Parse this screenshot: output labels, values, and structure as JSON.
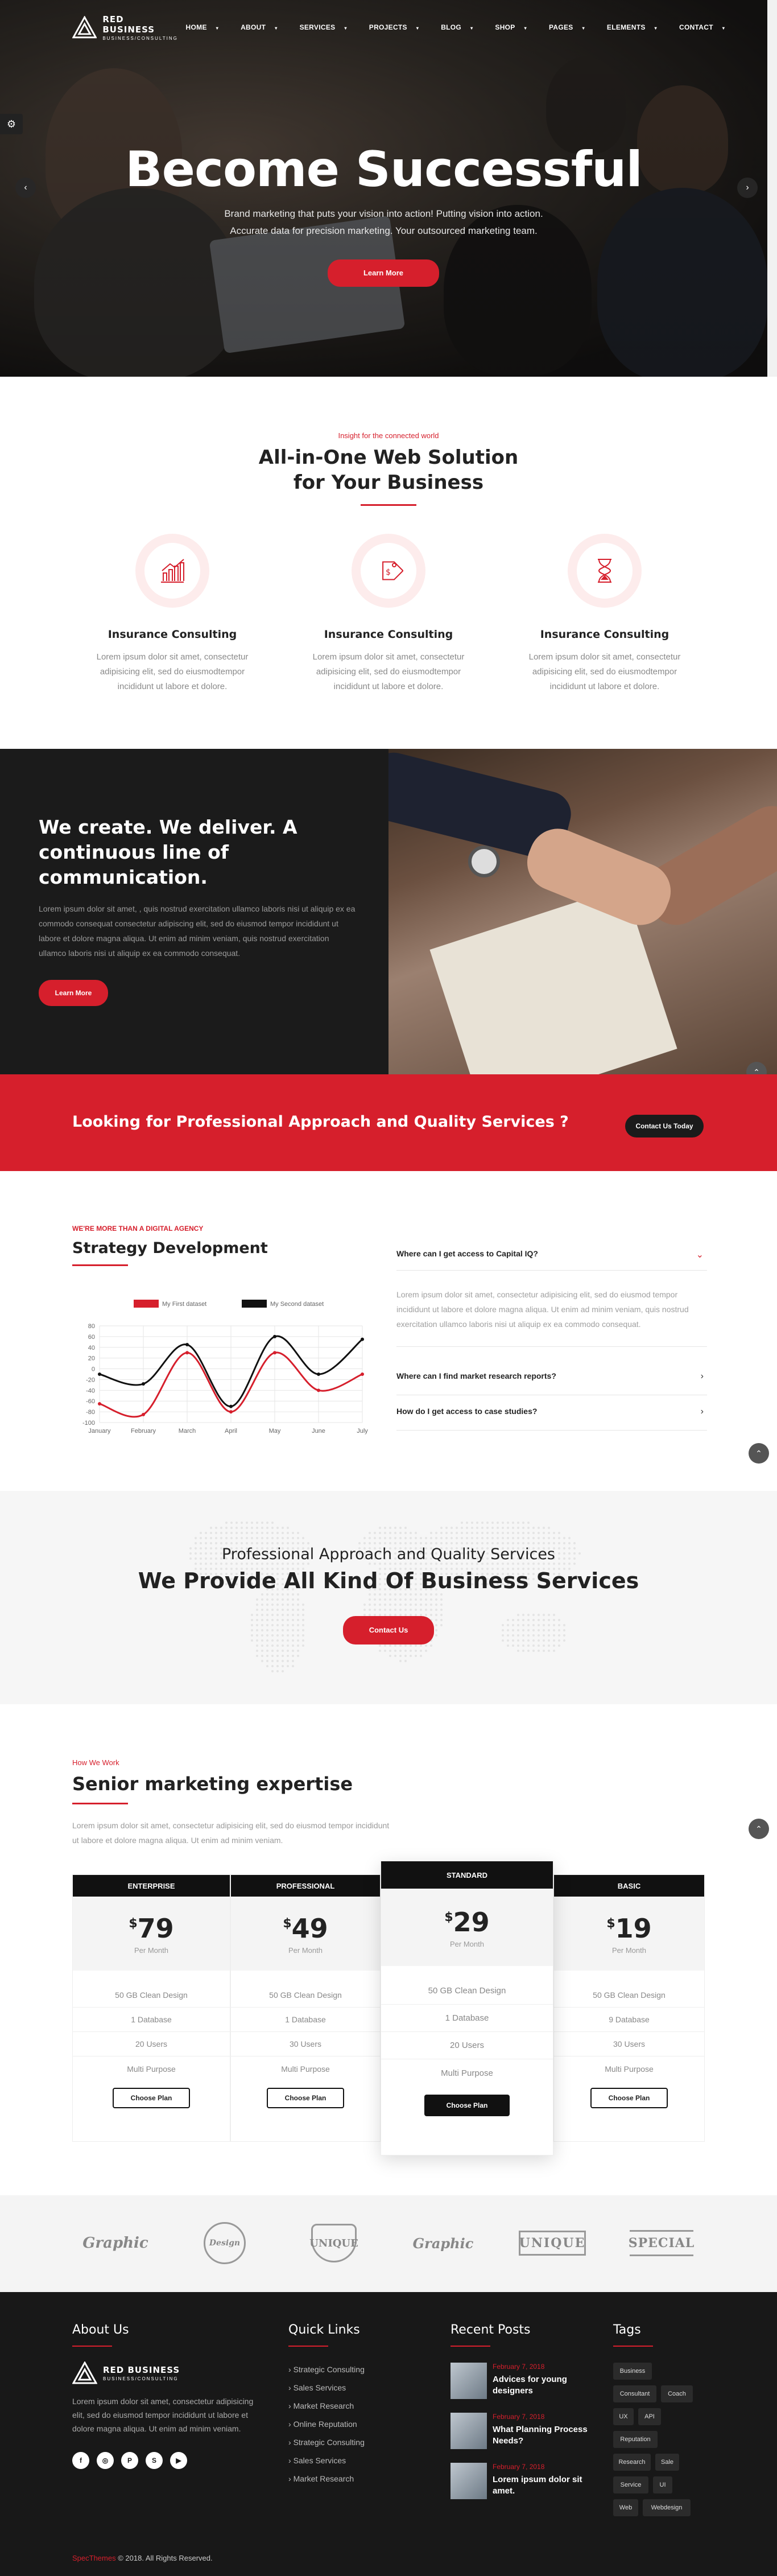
{
  "nav": {
    "brand_name": "RED BUSINESS",
    "brand_tagline": "BUSINESS/CONSULTING",
    "items": [
      "HOME",
      "ABOUT",
      "SERVICES",
      "PROJECTS",
      "BLOG",
      "SHOP",
      "PAGES",
      "ELEMENTS",
      "CONTACT"
    ]
  },
  "hero": {
    "title": "Become Successful",
    "line1": "Brand marketing that puts your vision into action! Putting vision into action.",
    "line2": "Accurate data for precision marketing. Your outsourced marketing team.",
    "button": "Learn More"
  },
  "intro": {
    "eyebrow": "Insight for the connected world",
    "title1": "All-in-One Web Solution",
    "title2": "for Your Business",
    "features": [
      {
        "title": "Insurance Consulting",
        "text": "Lorem ipsum dolor sit amet, consectetur adipisicing elit, sed do eiusmodtempor incididunt ut labore et dolore.",
        "icon": "chart-icon"
      },
      {
        "title": "Insurance Consulting",
        "text": "Lorem ipsum dolor sit amet, consectetur adipisicing elit, sed do eiusmodtempor incididunt ut labore et dolore.",
        "icon": "tag-icon"
      },
      {
        "title": "Insurance Consulting",
        "text": "Lorem ipsum dolor sit amet, consectetur adipisicing elit, sed do eiusmodtempor incididunt ut labore et dolore.",
        "icon": "hourglass-icon"
      }
    ]
  },
  "create": {
    "title": "We create. We deliver. A continuous line of communication.",
    "text": "Lorem ipsum dolor sit amet, , quis nostrud exercitation ullamco laboris nisi ut aliquip ex ea commodo consequat consectetur adipiscing elit, sed do eiusmod tempor incididunt ut labore et dolore magna aliqua. Ut enim ad minim veniam, quis nostrud exercitation ullamco laboris nisi ut aliquip ex ea commodo consequat.",
    "button": "Learn More"
  },
  "cta": {
    "title": "Looking for Professional Approach and Quality Services ?",
    "button": "Contact Us Today"
  },
  "strategy": {
    "eyebrow": "WE'RE MORE THAN A DIGITAL AGENCY",
    "title": "Strategy Development",
    "accordion": [
      {
        "q": "Where can I get access to Capital IQ?",
        "a": "Lorem ipsum dolor sit amet, consectetur adipisicing elit, sed do eiusmod tempor incididunt ut labore et dolore magna aliqua. Ut enim ad minim veniam, quis nostrud exercitation ullamco laboris nisi ut aliquip ex ea commodo consequat."
      },
      {
        "q": "Where can I find market research reports?",
        "a": ""
      },
      {
        "q": "How do I get access to case studies?",
        "a": ""
      }
    ]
  },
  "chart_data": {
    "type": "line",
    "categories": [
      "January",
      "February",
      "March",
      "April",
      "May",
      "June",
      "July"
    ],
    "series": [
      {
        "name": "My First dataset",
        "color": "#d61f2c",
        "values": [
          -65,
          -85,
          30,
          -80,
          30,
          -40,
          -10
        ]
      },
      {
        "name": "My Second dataset",
        "color": "#111111",
        "values": [
          -10,
          -28,
          45,
          -70,
          60,
          -10,
          55
        ]
      }
    ],
    "ylim": [
      -100,
      80
    ],
    "yticks": [
      80,
      60,
      40,
      20,
      0,
      -20,
      -40,
      -60,
      -80,
      -100
    ],
    "legend": "top",
    "grid": true
  },
  "services": {
    "sub": "Professional Approach and Quality Services",
    "title": "We Provide All Kind Of Business Services",
    "button": "Contact Us"
  },
  "pricing": {
    "eyebrow": "How We Work",
    "title": "Senior marketing expertise",
    "text": "Lorem ipsum dolor sit amet, consectetur adipisicing elit, sed do eiusmod tempor incididunt ut labore et dolore magna aliqua. Ut enim ad minim veniam.",
    "currency": "$",
    "per": "Per Month",
    "choose": "Choose Plan",
    "plans": [
      {
        "name": "ENTERPRISE",
        "price": "79",
        "features": [
          "50 GB Clean Design",
          "1 Database",
          "20 Users",
          "Multi Purpose"
        ]
      },
      {
        "name": "PROFESSIONAL",
        "price": "49",
        "features": [
          "50 GB Clean Design",
          "1 Database",
          "30 Users",
          "Multi Purpose"
        ]
      },
      {
        "name": "STANDARD",
        "price": "29",
        "features": [
          "50 GB Clean Design",
          "1 Database",
          "20 Users",
          "Multi Purpose"
        ]
      },
      {
        "name": "BASIC",
        "price": "19",
        "features": [
          "50 GB Clean Design",
          "9 Database",
          "30 Users",
          "Multi Purpose"
        ]
      }
    ]
  },
  "brands": [
    "Graphic",
    "Design",
    "UNIQUE",
    "Graphic",
    "UNIQUE",
    "SPECIAL"
  ],
  "footer": {
    "about_title": "About Us",
    "brand_name": "RED BUSINESS",
    "brand_tagline": "BUSINESS/CONSULTING",
    "about_text": "Lorem ipsum dolor sit amet, consectetur adipisicing elit, sed do eiusmod tempor incididunt ut labore et dolore magna aliqua. Ut enim ad minim veniam.",
    "social": [
      "facebook-icon",
      "instagram-icon",
      "pinterest-icon",
      "skype-icon",
      "youtube-icon"
    ],
    "links_title": "Quick Links",
    "links": [
      "Strategic Consulting",
      "Sales Services",
      "Market Research",
      "Online Reputation",
      "Strategic Consulting",
      "Sales Services",
      "Market Research"
    ],
    "posts_title": "Recent Posts",
    "posts": [
      {
        "date": "February 7, 2018",
        "title": "Advices for young designers"
      },
      {
        "date": "February 7, 2018",
        "title": "What Planning Process Needs?"
      },
      {
        "date": "February 7, 2018",
        "title": "Lorem ipsum dolor sit amet."
      }
    ],
    "tags_title": "Tags",
    "tags": [
      "Business",
      "Consultant",
      "Coach",
      "UX",
      "API",
      "Reputation",
      "Research",
      "Sale",
      "Service",
      "UI",
      "Web",
      "Webdesign"
    ],
    "copyright_brand": "SpecThemes",
    "copyright": "© 2018. All Rights Reserved."
  }
}
